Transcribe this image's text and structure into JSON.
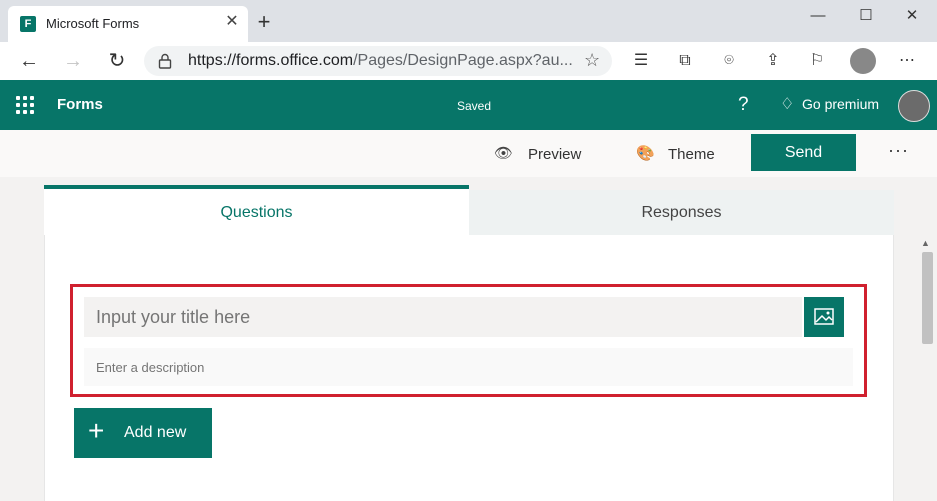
{
  "browser": {
    "tab_title": "Microsoft Forms",
    "tab_favicon": "F",
    "close_glyph": "✕",
    "newtab_glyph": "+",
    "url_domain": "https://forms.office.com",
    "url_path": "/Pages/DesignPage.aspx?au...",
    "window": {
      "minimize": "—",
      "maximize": "☐",
      "close": "✕"
    },
    "nav": {
      "back": "←",
      "forward": "→",
      "refresh": "↻",
      "star": "☆"
    },
    "toolbar_icons": [
      "favorites-icon",
      "collections-icon",
      "screenshot-icon",
      "share-icon",
      "feedback-icon",
      "profile-icon",
      "more-icon"
    ],
    "toolbar_glyphs": [
      "☰",
      "⧉",
      "⌾",
      "⇪",
      "⚐",
      "",
      "⋯"
    ]
  },
  "app": {
    "name": "Forms",
    "status": "Saved",
    "help": "?",
    "premium_icon": "♢",
    "premium_label": "Go premium",
    "accent": "#077568"
  },
  "commands": {
    "preview": "Preview",
    "preview_icon": "👁",
    "theme": "Theme",
    "theme_icon": "🎨",
    "send": "Send",
    "more": "···"
  },
  "tabs": {
    "questions": "Questions",
    "responses": "Responses"
  },
  "form": {
    "title_placeholder": "Input your title here",
    "description_placeholder": "Enter a description",
    "add_new_icon": "+",
    "add_new_label": "Add new"
  }
}
